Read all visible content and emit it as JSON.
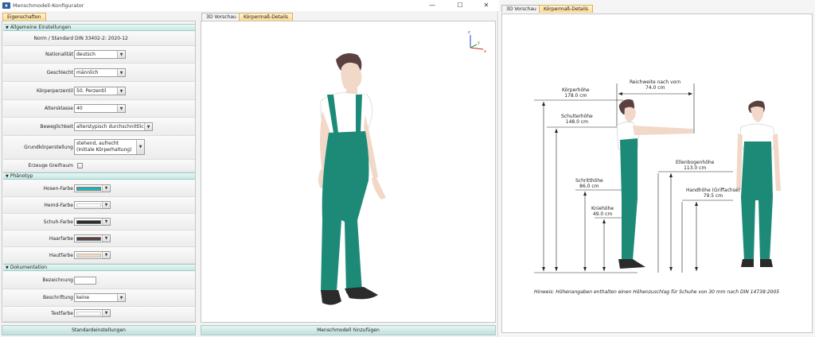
{
  "window": {
    "title": "Menschmodell-Konfigurator",
    "minimize": "—",
    "maximize": "☐",
    "close": "✕"
  },
  "tabs": {
    "properties": "Eigenschaften",
    "preview": "3D Vorschau",
    "details": "Körpermaß-Details"
  },
  "general": {
    "header": "Allgemeine Einstellungen",
    "norm_label": "Norm / Standard",
    "norm_value": "DIN 33402-2: 2020-12",
    "nationality_label": "Nationalität",
    "nationality_value": "deutsch",
    "gender_label": "Geschlecht",
    "gender_value": "männlich",
    "percentile_label": "Körperperzentil",
    "percentile_value": "50. Perzentil",
    "age_label": "Altersklasse",
    "age_value": "40",
    "mobility_label": "Beweglichkeit",
    "mobility_value": "alterstypisch durchschnittlich",
    "posture_label": "Grundkörperstellung",
    "posture_value": "stehend, aufrecht (Initiale Körperhaltung)",
    "reach_label": "Erzeuge Greifraum"
  },
  "phenotype": {
    "header": "Phänotyp",
    "pants_label": "Hosen-Farbe",
    "shirt_label": "Hemd-Farbe",
    "shoe_label": "Schuh-Farbe",
    "hair_label": "Haarfarbe",
    "skin_label": "Hautfarbe"
  },
  "documentation": {
    "header": "Dokumentation",
    "name_label": "Bezeichnung",
    "caption_label": "Beschriftung",
    "caption_value": "keine",
    "text_color_label": "Textfarbe"
  },
  "buttons": {
    "defaults": "Standardeinstellungen",
    "add_model": "Menschmodell hinzufügen"
  },
  "axes": {
    "x": "x",
    "y": "y",
    "z": "z"
  },
  "dimensions": {
    "body_height_label": "Körperhöhe",
    "body_height_value": "178.0 cm",
    "shoulder_label": "Schulterhöhe",
    "shoulder_value": "148.0 cm",
    "crotch_label": "Schritthöhe",
    "crotch_value": "86.0 cm",
    "knee_label": "Kniehöhe",
    "knee_value": "49.0 cm",
    "reach_label": "Reichweite nach vorn",
    "reach_value": "74.0 cm",
    "elbow_label": "Ellenbogenhöhe",
    "elbow_value": "113.0 cm",
    "hand_label": "Handhöhe (Griffachse)",
    "hand_value": "79.5 cm"
  },
  "hint": "Hinweis: Höhenangaben enthalten einen Höhenzuschlag für Schuhe von 30 mm nach DIN 14738:2005",
  "colors": {
    "pants": "#1fb6b4",
    "shirt": "#ffffff",
    "shoe": "#2b2b2b",
    "hair": "#5a4040",
    "skin": "#f2d8c8",
    "text": "#ffffff",
    "overall": "#1d8a78",
    "tab_active": "#ffd98a",
    "section": "#c7e7e3"
  }
}
